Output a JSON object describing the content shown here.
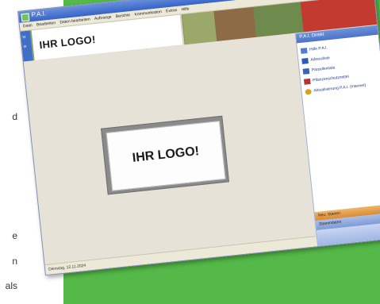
{
  "background_text": [
    {
      "id": "line-1",
      "text": "d"
    },
    {
      "id": "line-2",
      "text": "e"
    },
    {
      "id": "line-3",
      "text": "n"
    },
    {
      "id": "line-4",
      "text": "als"
    }
  ],
  "colors": {
    "panel_green": "#54b948",
    "titlebar_blue": "#3663c6",
    "side_orange": "#d88a33"
  },
  "window": {
    "title": "P.A.I.",
    "controls": [
      "minimize-icon",
      "maximize-icon",
      "close-icon"
    ]
  },
  "menu": {
    "items": [
      "Datei",
      "Bearbeiten",
      "Daten bearbeiten",
      "Auftraege",
      "Berichte",
      "Kommunikation",
      "Extras",
      "Hilfe"
    ]
  },
  "header": {
    "logo_text": "IHR LOGO!",
    "left_labels": [
      "H",
      "H"
    ]
  },
  "workspace": {
    "logo_card_text": "IHR LOGO!"
  },
  "side_panel": {
    "title": "P.A.I. Direkt",
    "items": [
      {
        "label": "Hilfe P.A.I.",
        "icon": "pencil-icon",
        "color": "#4f7ecf"
      },
      {
        "label": "Adressliste",
        "icon": "list-icon",
        "color": "#2f5bb8"
      },
      {
        "label": "Parzellenliste",
        "icon": "table-icon",
        "color": "#3a63b8"
      },
      {
        "label": "Pflanzenschutzmittel",
        "icon": "bottle-icon",
        "color": "#b8322f"
      },
      {
        "label": "Aktualisierung P.A.I. (Internet)",
        "icon": "globe-icon",
        "color": "#d9a21b"
      }
    ],
    "orange_button": "Neu: Starten",
    "blue_button": "Stammdaten",
    "chevron": "⌃"
  },
  "status": {
    "text": "Dienstag, 12.11.2024"
  }
}
